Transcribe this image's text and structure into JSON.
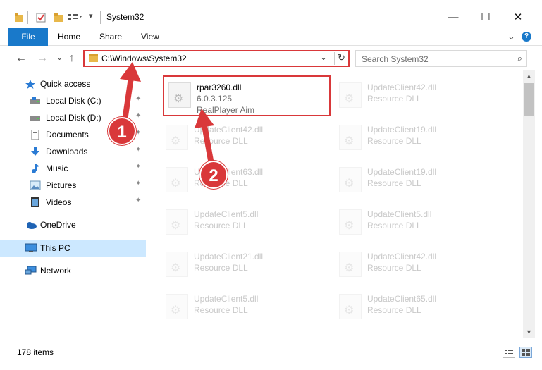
{
  "window": {
    "title": "System32",
    "minimize": "—",
    "maximize": "☐",
    "close": "✕"
  },
  "ribbon": {
    "tabs": [
      "File",
      "Home",
      "Share",
      "View"
    ],
    "expand": "⌄",
    "help": "?"
  },
  "navigation": {
    "back": "←",
    "forward": "→",
    "recent": "⌄",
    "up": "↑",
    "address": "C:\\Windows\\System32",
    "address_dropdown": "⌄",
    "refresh": "↻",
    "search_placeholder": "Search System32",
    "search_icon": "⌕"
  },
  "sidebar": {
    "items": [
      {
        "label": "Quick access",
        "icon": "star-icon",
        "pinned": false
      },
      {
        "label": "Local Disk (C:)",
        "icon": "drive-icon",
        "pinned": true
      },
      {
        "label": "Local Disk (D:)",
        "icon": "drive-icon",
        "pinned": true
      },
      {
        "label": "Documents",
        "icon": "documents-icon",
        "pinned": true
      },
      {
        "label": "Downloads",
        "icon": "downloads-icon",
        "pinned": true
      },
      {
        "label": "Music",
        "icon": "music-icon",
        "pinned": true
      },
      {
        "label": "Pictures",
        "icon": "pictures-icon",
        "pinned": true
      },
      {
        "label": "Videos",
        "icon": "videos-icon",
        "pinned": true
      },
      {
        "label": "OneDrive",
        "icon": "cloud-icon",
        "pinned": false
      },
      {
        "label": "This PC",
        "icon": "computer-icon",
        "pinned": false,
        "selected": true
      },
      {
        "label": "Network",
        "icon": "network-icon",
        "pinned": false
      }
    ],
    "pin_glyph": "📌"
  },
  "files": [
    {
      "name": "rpar3260.dll",
      "version": "6.0.3.125",
      "description": "RealPlayer Aim",
      "highlighted": true
    },
    {
      "name": "UpdateClient42.dll",
      "type": "Resource DLL"
    },
    {
      "name": "UpdateClient42.dll",
      "type": "Resource DLL"
    },
    {
      "name": "UpdateClient19.dll",
      "type": "Resource DLL"
    },
    {
      "name": "UpdateClient63.dll",
      "type": "Resource DLL"
    },
    {
      "name": "UpdateClient19.dll",
      "type": "Resource DLL"
    },
    {
      "name": "UpdateClient5.dll",
      "type": "Resource DLL"
    },
    {
      "name": "UpdateClient5.dll",
      "type": "Resource DLL"
    },
    {
      "name": "UpdateClient21.dll",
      "type": "Resource DLL"
    },
    {
      "name": "UpdateClient42.dll",
      "type": "Resource DLL"
    },
    {
      "name": "UpdateClient5.dll",
      "type": "Resource DLL"
    },
    {
      "name": "UpdateClient65.dll",
      "type": "Resource DLL"
    }
  ],
  "status": {
    "item_count": "178 items"
  },
  "annotations": {
    "step1": "1",
    "step2": "2"
  },
  "colors": {
    "accent": "#1979ca",
    "highlight_border": "#d9383a",
    "selection": "#cce8ff"
  }
}
